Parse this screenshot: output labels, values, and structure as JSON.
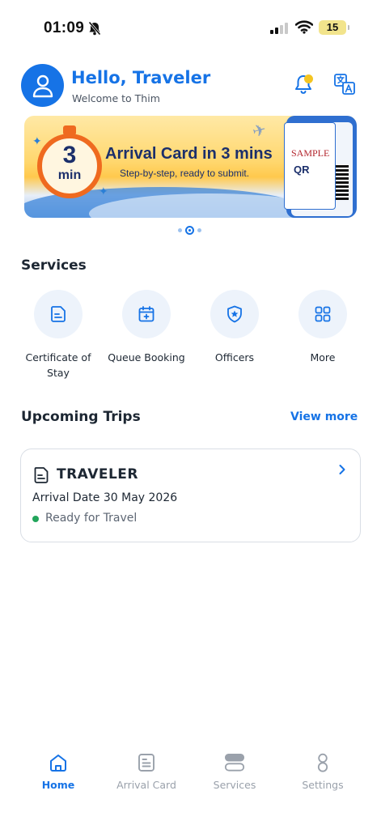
{
  "status_bar": {
    "time": "01:09",
    "battery": "15"
  },
  "header": {
    "greeting": "Hello, Traveler",
    "subtitle": "Welcome to Thim"
  },
  "banner": {
    "timer_number": "3",
    "timer_unit": "min",
    "title": "Arrival Card in 3 mins",
    "subtitle": "Step-by-step, ready to submit.",
    "sample_label": "SAMPLE",
    "qr_label": "QR",
    "page_count": 3,
    "active_page": 2
  },
  "services": {
    "title": "Services",
    "items": [
      {
        "label": "Certificate of Stay",
        "icon": "certificate-icon"
      },
      {
        "label": "Queue Booking",
        "icon": "calendar-plus-icon"
      },
      {
        "label": "Officers",
        "icon": "badge-star-icon"
      },
      {
        "label": "More",
        "icon": "grid-icon"
      }
    ]
  },
  "trips": {
    "title": "Upcoming Trips",
    "view_more": "View more",
    "items": [
      {
        "name": "TRAVELER",
        "date": "Arrival Date 30 May 2026",
        "status": "Ready for Travel"
      }
    ]
  },
  "nav": {
    "items": [
      {
        "label": "Home",
        "icon": "home-icon",
        "active": true
      },
      {
        "label": "Arrival Card",
        "icon": "card-icon",
        "active": false
      },
      {
        "label": "Services",
        "icon": "services-icon",
        "active": false
      },
      {
        "label": "Settings",
        "icon": "settings-icon",
        "active": false
      }
    ]
  },
  "colors": {
    "primary": "#1673e6",
    "status_ok": "#22a55b",
    "notification": "#f4c522"
  }
}
